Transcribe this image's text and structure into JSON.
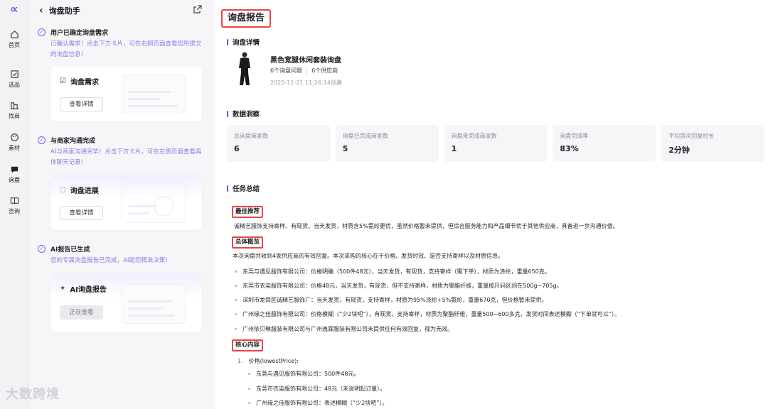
{
  "app": {
    "logo": "∝"
  },
  "rail": {
    "items": [
      {
        "label": "首页",
        "icon": "home-icon"
      },
      {
        "label": "选品",
        "icon": "select-product-icon"
      },
      {
        "label": "找商",
        "icon": "find-supplier-icon"
      },
      {
        "label": "素材",
        "icon": "palette-icon"
      },
      {
        "label": "询盘",
        "icon": "inquiry-icon",
        "active": true
      },
      {
        "label": "咨询",
        "icon": "book-icon"
      }
    ]
  },
  "panel": {
    "title": "询盘助手",
    "steps": [
      {
        "title": "用户已确定询盘需求",
        "desc": "已确认需求！点击下方卡片，可在右侧页面查看您所提交的询盘信息！",
        "card_title": "询盘需求",
        "card_button": "查看详情"
      },
      {
        "title": "与商家沟通完成",
        "desc": "AI与商家沟通完毕！点击下方卡片，可在右侧页面查看具体聊天记录！",
        "card_title": "询盘进展",
        "card_button": "查看详情"
      },
      {
        "title": "AI报告已生成",
        "desc": "您的专属询盘报告已完成，AI助您精准决策！",
        "card_title": "AI询盘报告",
        "card_button": "正在查看"
      }
    ]
  },
  "report": {
    "title": "询盘报告",
    "detail_heading": "询盘详情",
    "product": {
      "name": "黑色宽腿休闲套装询盘",
      "questions": "6个询盘问题",
      "suppliers": "6个供应商",
      "created": "2025-11-21 11:26:14创建"
    },
    "insight_heading": "数据洞察",
    "stats": [
      {
        "label": "总询盘商家数",
        "value": "6"
      },
      {
        "label": "询盘已完成商家数",
        "value": "5"
      },
      {
        "label": "询盘未完成商家数",
        "value": "1"
      },
      {
        "label": "询盘完成率",
        "value": "83%"
      },
      {
        "label": "平均首次回复时长",
        "value": "2分钟"
      }
    ],
    "summary_heading": "任务总结",
    "best_tag": "最佳推荐",
    "best_text": "诚精艺服饰支持寄样、有现货、当天发货，材质含5%氨纶更优，虽然价格暂未提供，但综合服务能力和产品细节优于其他供应商，具备进一步沟通价值。",
    "overview_tag": "总体概览",
    "overview_text": "本次询盘共收到4家供应商的有效回复。本次采购的核心在于价格、发货时效、是否支持寄样以及材质信息。",
    "overview_items": [
      "东莞与遇见服饰有限公司：价格明确（500件48元），当天发货，有现货，支持寄样（需下单），材质为涤纶，重量650克。",
      "东莞市衣染服饰有限公司：价格48元，当天发货，有现货，但不支持寄样，材质为聚酯纤维，重量按尺码区间在500g~705g。",
      "深圳市龙岗区诚精艺服饰厂：当天发货，有现货，支持寄样，材质为95%涤纶+5%氨纶，重量670克，但价格暂未提供。",
      "广州缘之佳服饰有限公司：价格模糊（“少2块吧”），有现货，支持寄样，材质为聚酯纤维，重量500~600多克，发货时间表述模糊（“下单就可以”）。",
      "广州依贝琳服装有限公司与广州逸霖服装有限公司未提供任何有效回复，视为无效。"
    ],
    "core_tag": "核心内容",
    "core_num": "1.",
    "core_item": "价格(lowestPrice):",
    "core_subs": [
      "东莞与遇见服饰有限公司：500件48元。",
      "东莞市衣染服饰有限公司：48元（未说明起订量）。",
      "广州缘之佳服饰有限公司：表述模糊（“少2块吧”）。"
    ]
  },
  "watermark": "大数跨境"
}
